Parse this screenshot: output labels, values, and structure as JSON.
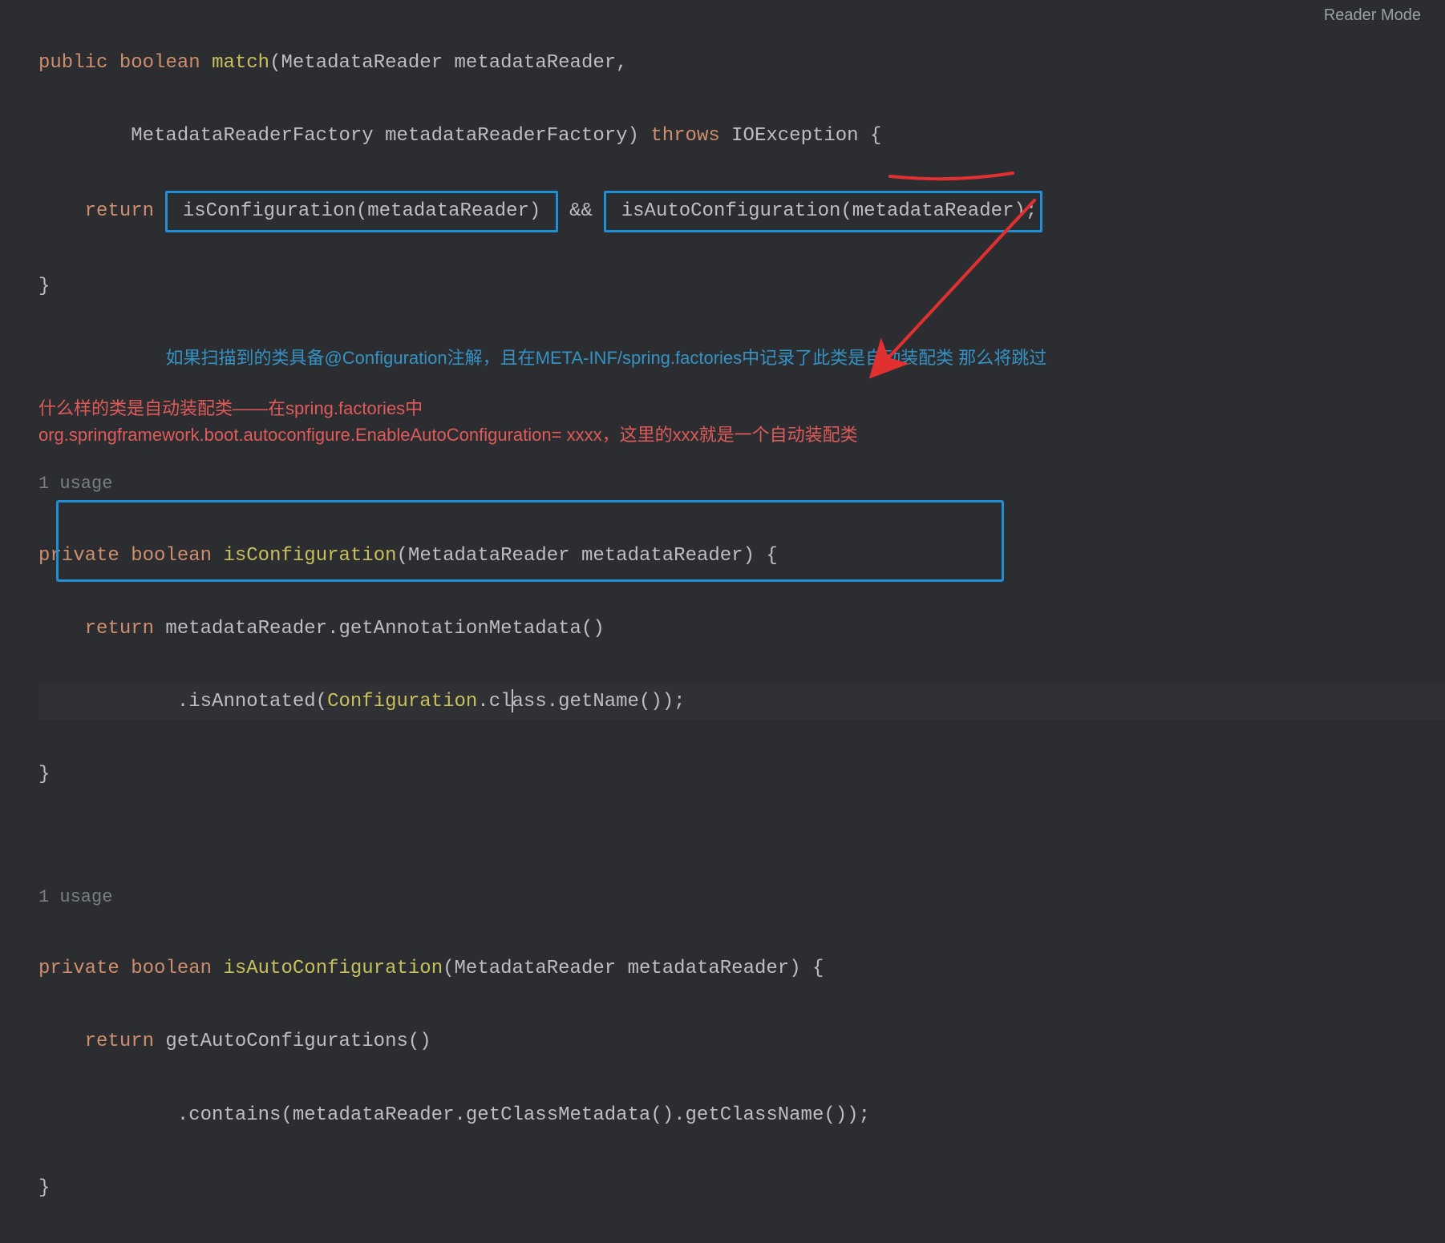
{
  "readerMode": "Reader Mode",
  "code": {
    "l1": {
      "kw1": "public",
      "kw2": "boolean",
      "m": "match",
      "p": "(MetadataReader metadataReader,"
    },
    "l2": {
      "indent": "        ",
      "p": "MetadataReaderFactory metadataReaderFactory) ",
      "kw": "throws",
      "ex": " IOException {"
    },
    "l3": {
      "indent": "    ",
      "kw": "return",
      "sp1": " ",
      "box1": " isConfiguration(metadataReader) ",
      "mid": " && ",
      "box2": " isAutoConfiguration(metadataReader);"
    },
    "l4": {
      "brace": "}"
    },
    "l5": {
      "indent": "           ",
      "comment": "如果扫描到的类具备@Configuration注解，且在META-INF/spring.factories中记录了此类是自动装配类 那么将跳过"
    },
    "usage1": "1 usage",
    "l7": {
      "kw1": "private",
      "kw2": "boolean",
      "m": "isConfiguration",
      "p": "(MetadataReader metadataReader) {"
    },
    "l8": {
      "indent": "    ",
      "kw": "return",
      "rest": " metadataReader.getAnnotationMetadata()"
    },
    "l9": {
      "indent": "            ",
      "a": ".isAnnotated(",
      "c": "Configuration",
      "d": ".cl",
      "e": "ass",
      "f": ".getName());"
    },
    "l10": {
      "brace": "}"
    },
    "redNote1": "什么样的类是自动装配类——在spring.factories中",
    "redNote2": "org.springframework.boot.autoconfigure.EnableAutoConfiguration=  xxxx，这里的xxx就是一个自动装配类",
    "usage2": "1 usage",
    "l13": {
      "kw1": "private",
      "kw2": "boolean",
      "m": "isAutoConfiguration",
      "p": "(MetadataReader metadataReader) {"
    },
    "l14": {
      "indent": "    ",
      "kw": "return",
      "rest": " getAutoConfigurations()"
    },
    "l15": {
      "indent": "            ",
      "rest": ".contains(metadataReader.getClassMetadata().getClassName());"
    },
    "l16": {
      "brace": "}"
    }
  }
}
